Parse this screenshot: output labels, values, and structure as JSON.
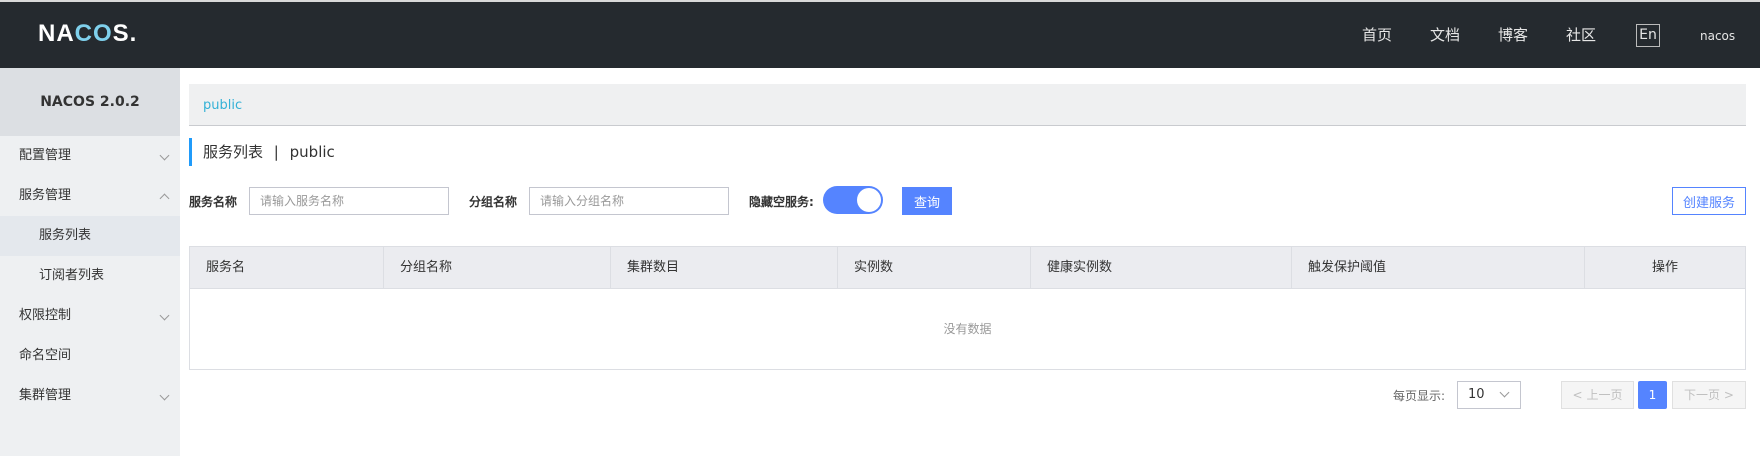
{
  "header": {
    "logo": {
      "pre": "NA",
      "mid": "CO",
      "post": "S."
    },
    "nav": [
      "首页",
      "文档",
      "博客",
      "社区"
    ],
    "lang": "En",
    "user": "nacos"
  },
  "sidebar": {
    "title": "NACOS 2.0.2",
    "items": [
      "配置管理",
      "服务管理",
      "服务列表",
      "订阅者列表",
      "权限控制",
      "命名空间",
      "集群管理"
    ]
  },
  "breadcrumb": "public",
  "page": {
    "title": "服务列表",
    "separator": "|",
    "namespace": "public"
  },
  "filters": {
    "service_label": "服务名称",
    "service_placeholder": "请输入服务名称",
    "group_label": "分组名称",
    "group_placeholder": "请输入分组名称",
    "hide_empty_label": "隐藏空服务:",
    "hide_empty_on": true,
    "query_label": "查询",
    "create_label": "创建服务"
  },
  "table": {
    "columns": [
      "服务名",
      "分组名称",
      "集群数目",
      "实例数",
      "健康实例数",
      "触发保护阈值",
      "操作"
    ],
    "empty_text": "没有数据"
  },
  "pagination": {
    "per_page_label": "每页显示:",
    "page_size": "10",
    "prev_label": "上一页",
    "current_page": "1",
    "next_label": "下一页"
  },
  "colors": {
    "primary": "#5584ff",
    "header_bg": "#252a2f",
    "link": "#34b1d6"
  }
}
